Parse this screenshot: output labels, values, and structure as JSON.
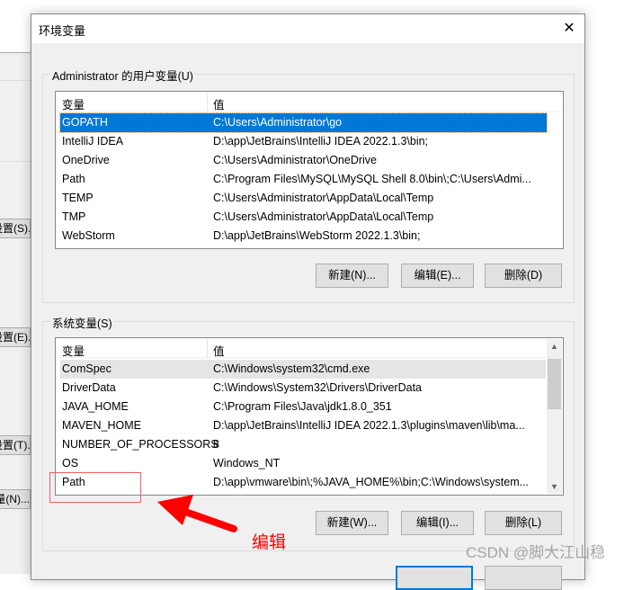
{
  "background_window": {
    "buttons": [
      "设置(S).",
      "设置(E).",
      "设置(T).",
      "量(N)..."
    ]
  },
  "dialog": {
    "title": "环境变量",
    "close_icon": "close-icon",
    "user_vars": {
      "label": "Administrator 的用户变量(U)",
      "columns": [
        "变量",
        "值"
      ],
      "selected": 0,
      "rows": [
        [
          "GOPATH",
          "C:\\Users\\Administrator\\go"
        ],
        [
          "IntelliJ IDEA",
          "D:\\app\\JetBrains\\IntelliJ IDEA 2022.1.3\\bin;"
        ],
        [
          "OneDrive",
          "C:\\Users\\Administrator\\OneDrive"
        ],
        [
          "Path",
          "C:\\Program Files\\MySQL\\MySQL Shell 8.0\\bin\\;C:\\Users\\Admi..."
        ],
        [
          "TEMP",
          "C:\\Users\\Administrator\\AppData\\Local\\Temp"
        ],
        [
          "TMP",
          "C:\\Users\\Administrator\\AppData\\Local\\Temp"
        ],
        [
          "WebStorm",
          "D:\\app\\JetBrains\\WebStorm 2022.1.3\\bin;"
        ]
      ],
      "buttons": {
        "new": "新建(N)...",
        "edit": "编辑(E)...",
        "delete": "删除(D)"
      }
    },
    "system_vars": {
      "label": "系统变量(S)",
      "columns": [
        "变量",
        "值"
      ],
      "rows": [
        [
          "ComSpec",
          "C:\\Windows\\system32\\cmd.exe"
        ],
        [
          "DriverData",
          "C:\\Windows\\System32\\Drivers\\DriverData"
        ],
        [
          "JAVA_HOME",
          "C:\\Program Files\\Java\\jdk1.8.0_351"
        ],
        [
          "MAVEN_HOME",
          "D:\\app\\JetBrains\\IntelliJ IDEA 2022.1.3\\plugins\\maven\\lib\\ma..."
        ],
        [
          "NUMBER_OF_PROCESSORS",
          "8"
        ],
        [
          "OS",
          "Windows_NT"
        ],
        [
          "Path",
          "D:\\app\\vmware\\bin\\;%JAVA_HOME%\\bin;C:\\Windows\\system..."
        ]
      ],
      "buttons": {
        "new": "新建(W)...",
        "edit": "编辑(I)...",
        "delete": "删除(L)"
      }
    }
  },
  "annotation": {
    "label": "编辑",
    "color": "#ff0000"
  },
  "watermark": "CSDN @脚大江山稳"
}
